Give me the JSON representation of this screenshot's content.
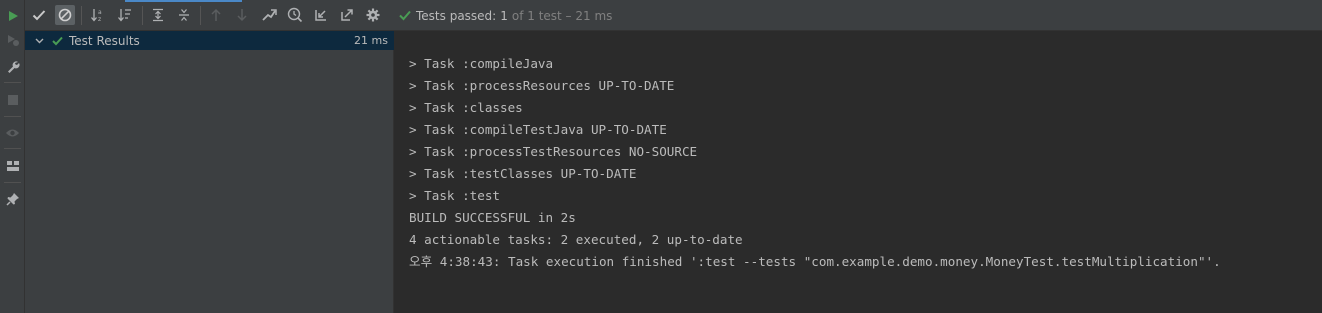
{
  "colors": {
    "accent_green": "#499c54",
    "text": "#bbbbbb",
    "selection": "#0d293e",
    "panel": "#3c3f41",
    "console_bg": "#2b2b2b"
  },
  "left_bar": {
    "icons": [
      "run-icon",
      "rerun-failed-icon",
      "wrench-icon",
      "stop-icon",
      "eye-icon",
      "layout-icon",
      "pin-icon"
    ]
  },
  "toolbar": {
    "icons": [
      "show-passed-icon",
      "show-ignored-icon",
      "sort-alpha-icon",
      "sort-duration-icon",
      "expand-all-icon",
      "collapse-all-icon",
      "previous-icon",
      "next-icon",
      "import-tests-icon",
      "history-icon",
      "export-icon",
      "open-external-icon",
      "gear-icon"
    ]
  },
  "status": {
    "label": "Tests passed: ",
    "count": "1",
    "detail": "of 1 test – 21 ms"
  },
  "tree": {
    "root_label": "Test Results",
    "root_time": "21 ms"
  },
  "console": {
    "lines": [
      "> Task :compileJava",
      "> Task :processResources UP-TO-DATE",
      "> Task :classes",
      "> Task :compileTestJava UP-TO-DATE",
      "> Task :processTestResources NO-SOURCE",
      "> Task :testClasses UP-TO-DATE",
      "> Task :test",
      "BUILD SUCCESSFUL in 2s",
      "4 actionable tasks: 2 executed, 2 up-to-date",
      "오후 4:38:43: Task execution finished ':test --tests \"com.example.demo.money.MoneyTest.testMultiplication\"'."
    ]
  }
}
